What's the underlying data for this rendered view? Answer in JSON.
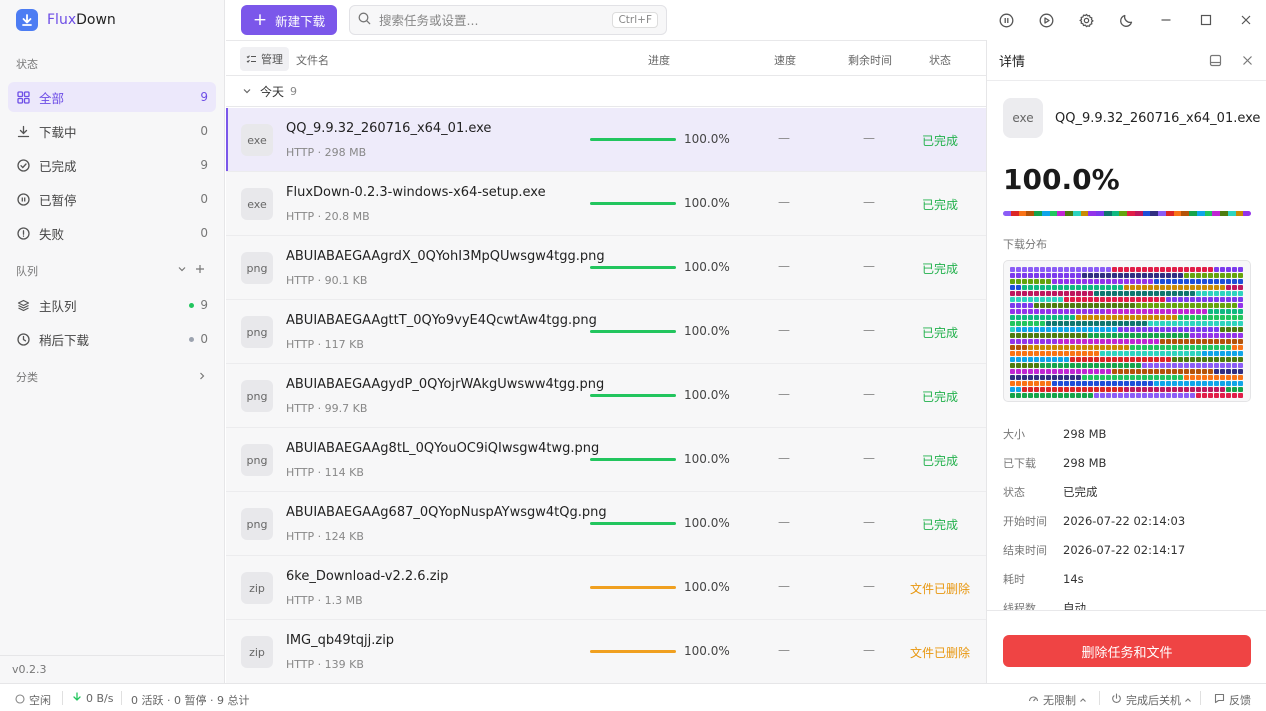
{
  "app": {
    "name_accent": "Flux",
    "name_rest": "Down",
    "version": "v0.2.3"
  },
  "sidebar": {
    "status_label": "状态",
    "status_items": [
      {
        "label": "全部",
        "count": "9"
      },
      {
        "label": "下载中",
        "count": "0"
      },
      {
        "label": "已完成",
        "count": "9"
      },
      {
        "label": "已暂停",
        "count": "0"
      },
      {
        "label": "失败",
        "count": "0"
      }
    ],
    "queue_label": "队列",
    "queue_items": [
      {
        "label": "主队列",
        "count": "9",
        "dot": "#22c55e"
      },
      {
        "label": "稍后下载",
        "count": "0",
        "dot": "#9ca3af"
      }
    ],
    "category_label": "分类"
  },
  "toolbar": {
    "new_download": "新建下载",
    "search_placeholder": "搜索任务或设置...",
    "search_shortcut": "Ctrl+F"
  },
  "table": {
    "manage": "管理",
    "col_name": "文件名",
    "col_progress": "进度",
    "col_speed": "速度",
    "col_remaining": "剩余时间",
    "col_status": "状态",
    "group_label": "今天",
    "group_count": "9",
    "rows": [
      {
        "type": "exe",
        "name": "QQ_9.9.32_260716_x64_01.exe",
        "meta": "HTTP · 298 MB",
        "progress": "100.0%",
        "speed": "—",
        "remaining": "—",
        "status": "已完成",
        "state": "done"
      },
      {
        "type": "exe",
        "name": "FluxDown-0.2.3-windows-x64-setup.exe",
        "meta": "HTTP · 20.8 MB",
        "progress": "100.0%",
        "speed": "—",
        "remaining": "—",
        "status": "已完成",
        "state": "done"
      },
      {
        "type": "png",
        "name": "ABUIABAEGAAgrdX_0QYohI3MpQUwsgw4tgg.png",
        "meta": "HTTP · 90.1 KB",
        "progress": "100.0%",
        "speed": "—",
        "remaining": "—",
        "status": "已完成",
        "state": "done"
      },
      {
        "type": "png",
        "name": "ABUIABAEGAAgttT_0QYo9vyE4QcwtAw4tgg.png",
        "meta": "HTTP · 117 KB",
        "progress": "100.0%",
        "speed": "—",
        "remaining": "—",
        "status": "已完成",
        "state": "done"
      },
      {
        "type": "png",
        "name": "ABUIABAEGAAgydP_0QYojrWAkgUwsww4tgg.png",
        "meta": "HTTP · 99.7 KB",
        "progress": "100.0%",
        "speed": "—",
        "remaining": "—",
        "status": "已完成",
        "state": "done"
      },
      {
        "type": "png",
        "name": "ABUIABAEGAAg8tL_0QYouOC9iQIwsgw4twg.png",
        "meta": "HTTP · 114 KB",
        "progress": "100.0%",
        "speed": "—",
        "remaining": "—",
        "status": "已完成",
        "state": "done"
      },
      {
        "type": "png",
        "name": "ABUIABAEGAAg687_0QYopNuspAYwsgw4tQg.png",
        "meta": "HTTP · 124 KB",
        "progress": "100.0%",
        "speed": "—",
        "remaining": "—",
        "status": "已完成",
        "state": "done"
      },
      {
        "type": "zip",
        "name": "6ke_Download-v2.2.6.zip",
        "meta": "HTTP · 1.3 MB",
        "progress": "100.0%",
        "speed": "—",
        "remaining": "—",
        "status": "文件已删除",
        "state": "deleted"
      },
      {
        "type": "zip",
        "name": "IMG_qb49tqjj.zip",
        "meta": "HTTP · 139 KB",
        "progress": "100.0%",
        "speed": "—",
        "remaining": "—",
        "status": "文件已删除",
        "state": "deleted"
      }
    ]
  },
  "detail": {
    "title": "详情",
    "file_type": "exe",
    "file_name": "QQ_9.9.32_260716_x64_01.exe",
    "percent": "100.0%",
    "distribution_label": "下载分布",
    "fields": [
      {
        "key": "大小",
        "value": "298 MB"
      },
      {
        "key": "已下载",
        "value": "298 MB"
      },
      {
        "key": "状态",
        "value": "已完成"
      },
      {
        "key": "开始时间",
        "value": "2026-07-22 02:14:03"
      },
      {
        "key": "结束时间",
        "value": "2026-07-22 02:14:17"
      },
      {
        "key": "耗时",
        "value": "14s"
      },
      {
        "key": "线程数",
        "value": "自动"
      }
    ],
    "delete_button": "删除任务和文件"
  },
  "statusbar": {
    "idle": "空闲",
    "speed": "0 B/s",
    "summary": "0 活跃 · 0 暂停 · 9 总计",
    "limit": "无限制",
    "after_done": "完成后关机",
    "feedback": "反馈"
  },
  "colors": {
    "accent": "#7b57ea",
    "done": "#22b14c",
    "deleted": "#e8970f",
    "progress_done": "#22c55e",
    "progress_deleted": "#f0a020",
    "danger": "#ef4444",
    "segments": [
      "#8b5cf6",
      "#b45309",
      "#22c55e",
      "#2dd4bf",
      "#7c3aed",
      "#65a30d",
      "#1d4ed8",
      "#dc2626",
      "#16a34a",
      "#c026d3",
      "#ca8a04",
      "#0f766e",
      "#e11d48",
      "#312e81",
      "#f97316",
      "#0ea5e9",
      "#4d7c0f",
      "#9333ea",
      "#10b981",
      "#be185d"
    ]
  }
}
